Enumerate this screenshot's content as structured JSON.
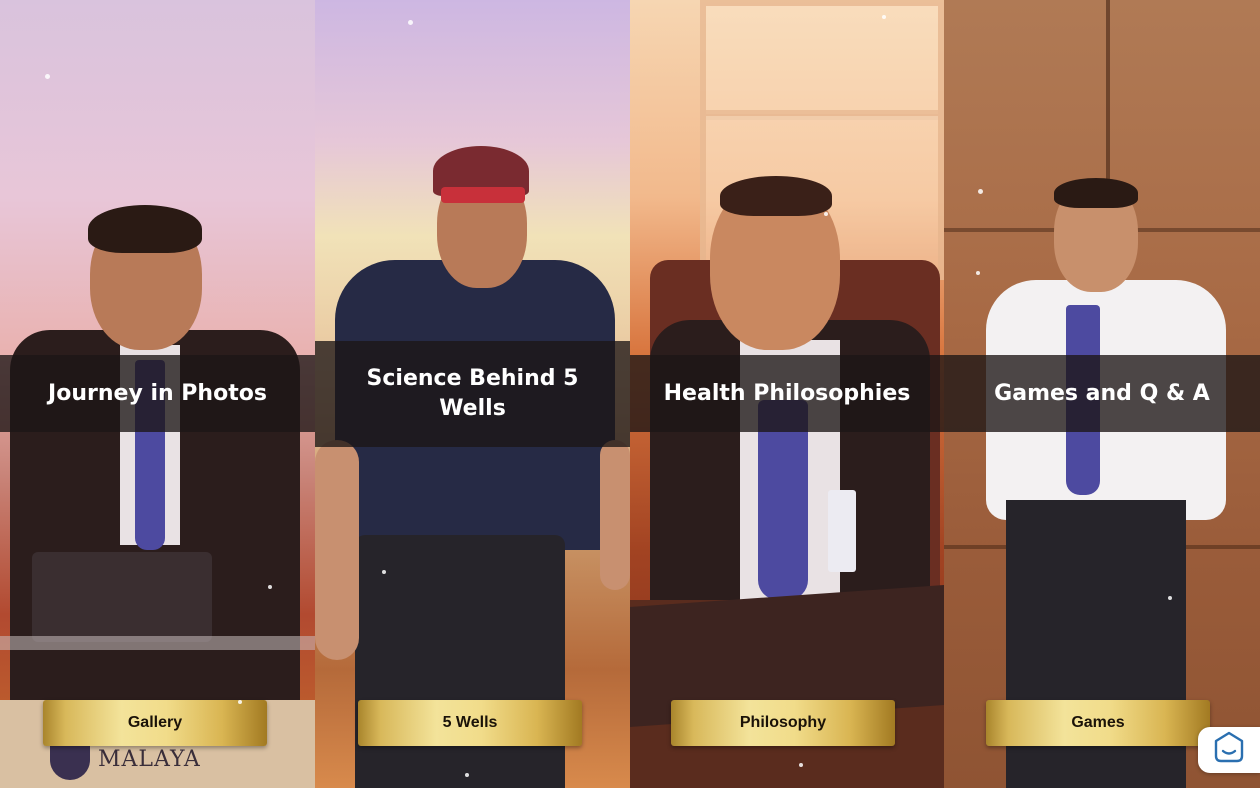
{
  "panels": [
    {
      "title": "Journey in Photos",
      "button_label": "Gallery"
    },
    {
      "title": "Science Behind 5 Wells",
      "button_label": "5 Wells"
    },
    {
      "title": "Health Philosophies",
      "button_label": "Philosophy"
    },
    {
      "title": "Games and Q & A",
      "button_label": "Games"
    }
  ],
  "podium_text": "MALAYA",
  "chat_widget": {
    "icon": "chat-bubble-smile-icon"
  },
  "colors": {
    "band": "#1c1616",
    "gold": "#f3e39a",
    "chat_icon": "#2a6fb0"
  }
}
